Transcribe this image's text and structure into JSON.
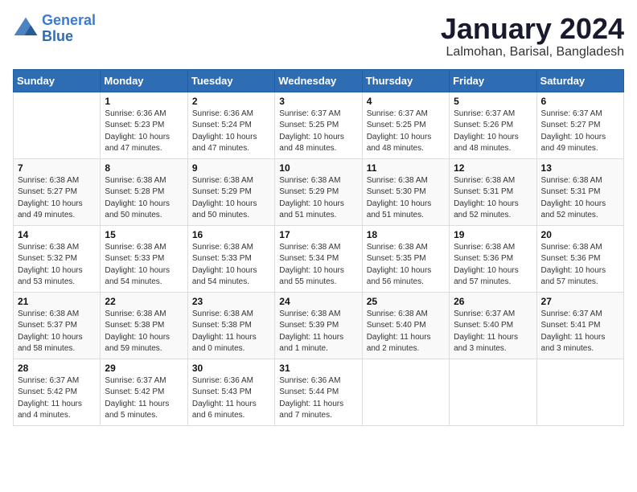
{
  "header": {
    "logo_line1": "General",
    "logo_line2": "Blue",
    "month": "January 2024",
    "location": "Lalmohan, Barisal, Bangladesh"
  },
  "days_of_week": [
    "Sunday",
    "Monday",
    "Tuesday",
    "Wednesday",
    "Thursday",
    "Friday",
    "Saturday"
  ],
  "weeks": [
    [
      {
        "day": "",
        "info": ""
      },
      {
        "day": "1",
        "info": "Sunrise: 6:36 AM\nSunset: 5:23 PM\nDaylight: 10 hours\nand 47 minutes."
      },
      {
        "day": "2",
        "info": "Sunrise: 6:36 AM\nSunset: 5:24 PM\nDaylight: 10 hours\nand 47 minutes."
      },
      {
        "day": "3",
        "info": "Sunrise: 6:37 AM\nSunset: 5:25 PM\nDaylight: 10 hours\nand 48 minutes."
      },
      {
        "day": "4",
        "info": "Sunrise: 6:37 AM\nSunset: 5:25 PM\nDaylight: 10 hours\nand 48 minutes."
      },
      {
        "day": "5",
        "info": "Sunrise: 6:37 AM\nSunset: 5:26 PM\nDaylight: 10 hours\nand 48 minutes."
      },
      {
        "day": "6",
        "info": "Sunrise: 6:37 AM\nSunset: 5:27 PM\nDaylight: 10 hours\nand 49 minutes."
      }
    ],
    [
      {
        "day": "7",
        "info": "Sunrise: 6:38 AM\nSunset: 5:27 PM\nDaylight: 10 hours\nand 49 minutes."
      },
      {
        "day": "8",
        "info": "Sunrise: 6:38 AM\nSunset: 5:28 PM\nDaylight: 10 hours\nand 50 minutes."
      },
      {
        "day": "9",
        "info": "Sunrise: 6:38 AM\nSunset: 5:29 PM\nDaylight: 10 hours\nand 50 minutes."
      },
      {
        "day": "10",
        "info": "Sunrise: 6:38 AM\nSunset: 5:29 PM\nDaylight: 10 hours\nand 51 minutes."
      },
      {
        "day": "11",
        "info": "Sunrise: 6:38 AM\nSunset: 5:30 PM\nDaylight: 10 hours\nand 51 minutes."
      },
      {
        "day": "12",
        "info": "Sunrise: 6:38 AM\nSunset: 5:31 PM\nDaylight: 10 hours\nand 52 minutes."
      },
      {
        "day": "13",
        "info": "Sunrise: 6:38 AM\nSunset: 5:31 PM\nDaylight: 10 hours\nand 52 minutes."
      }
    ],
    [
      {
        "day": "14",
        "info": "Sunrise: 6:38 AM\nSunset: 5:32 PM\nDaylight: 10 hours\nand 53 minutes."
      },
      {
        "day": "15",
        "info": "Sunrise: 6:38 AM\nSunset: 5:33 PM\nDaylight: 10 hours\nand 54 minutes."
      },
      {
        "day": "16",
        "info": "Sunrise: 6:38 AM\nSunset: 5:33 PM\nDaylight: 10 hours\nand 54 minutes."
      },
      {
        "day": "17",
        "info": "Sunrise: 6:38 AM\nSunset: 5:34 PM\nDaylight: 10 hours\nand 55 minutes."
      },
      {
        "day": "18",
        "info": "Sunrise: 6:38 AM\nSunset: 5:35 PM\nDaylight: 10 hours\nand 56 minutes."
      },
      {
        "day": "19",
        "info": "Sunrise: 6:38 AM\nSunset: 5:36 PM\nDaylight: 10 hours\nand 57 minutes."
      },
      {
        "day": "20",
        "info": "Sunrise: 6:38 AM\nSunset: 5:36 PM\nDaylight: 10 hours\nand 57 minutes."
      }
    ],
    [
      {
        "day": "21",
        "info": "Sunrise: 6:38 AM\nSunset: 5:37 PM\nDaylight: 10 hours\nand 58 minutes."
      },
      {
        "day": "22",
        "info": "Sunrise: 6:38 AM\nSunset: 5:38 PM\nDaylight: 10 hours\nand 59 minutes."
      },
      {
        "day": "23",
        "info": "Sunrise: 6:38 AM\nSunset: 5:38 PM\nDaylight: 11 hours\nand 0 minutes."
      },
      {
        "day": "24",
        "info": "Sunrise: 6:38 AM\nSunset: 5:39 PM\nDaylight: 11 hours\nand 1 minute."
      },
      {
        "day": "25",
        "info": "Sunrise: 6:38 AM\nSunset: 5:40 PM\nDaylight: 11 hours\nand 2 minutes."
      },
      {
        "day": "26",
        "info": "Sunrise: 6:37 AM\nSunset: 5:40 PM\nDaylight: 11 hours\nand 3 minutes."
      },
      {
        "day": "27",
        "info": "Sunrise: 6:37 AM\nSunset: 5:41 PM\nDaylight: 11 hours\nand 3 minutes."
      }
    ],
    [
      {
        "day": "28",
        "info": "Sunrise: 6:37 AM\nSunset: 5:42 PM\nDaylight: 11 hours\nand 4 minutes."
      },
      {
        "day": "29",
        "info": "Sunrise: 6:37 AM\nSunset: 5:42 PM\nDaylight: 11 hours\nand 5 minutes."
      },
      {
        "day": "30",
        "info": "Sunrise: 6:36 AM\nSunset: 5:43 PM\nDaylight: 11 hours\nand 6 minutes."
      },
      {
        "day": "31",
        "info": "Sunrise: 6:36 AM\nSunset: 5:44 PM\nDaylight: 11 hours\nand 7 minutes."
      },
      {
        "day": "",
        "info": ""
      },
      {
        "day": "",
        "info": ""
      },
      {
        "day": "",
        "info": ""
      }
    ]
  ]
}
